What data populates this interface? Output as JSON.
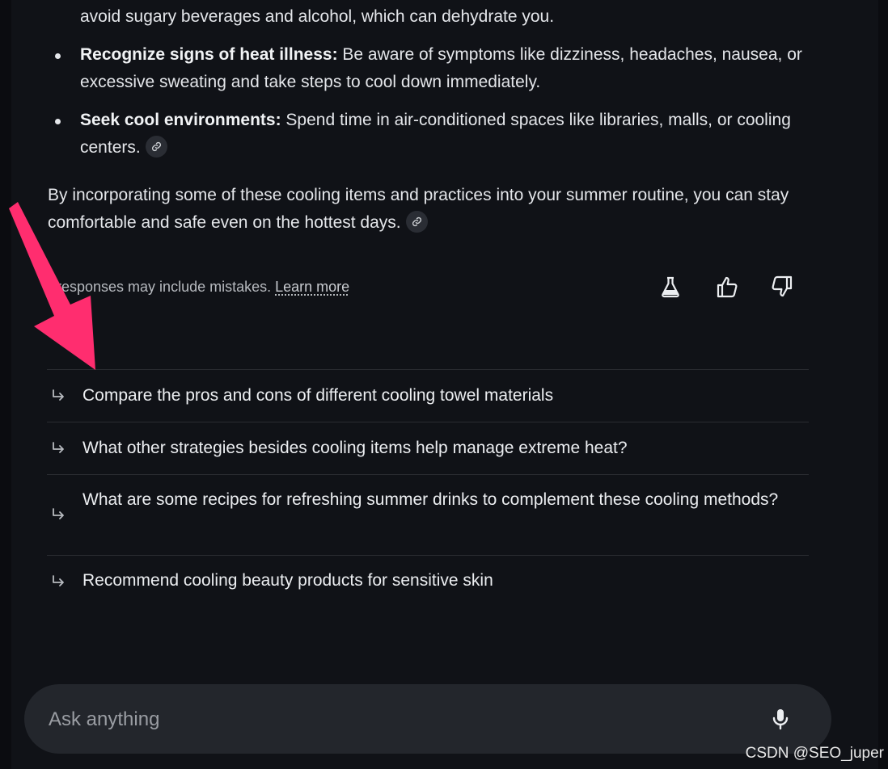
{
  "response": {
    "hydrate_continuation": "avoid sugary beverages and alcohol, which can dehydrate you.",
    "bullets": [
      {
        "bold": "Recognize signs of heat illness:",
        "text": " Be aware of symptoms like dizziness, headaches, nausea, or excessive sweating and take steps to cool down immediately."
      },
      {
        "bold": "Seek cool environments:",
        "text": " Spend time in air-conditioned spaces like libraries, malls, or cooling centers."
      }
    ],
    "closing_paragraph": "By incorporating some of these cooling items and practices into your summer routine, you can stay comfortable and safe even on the hottest days."
  },
  "disclaimer": {
    "text": "responses may include mistakes.",
    "learn_more": "Learn more"
  },
  "actions": {
    "labs_icon": "flask-icon",
    "thumbs_up_icon": "thumbs-up-icon",
    "thumbs_down_icon": "thumbs-down-icon"
  },
  "suggestions": [
    "Compare the pros and cons of different cooling towel materials",
    "What other strategies besides cooling items help manage extreme heat?",
    "What are some recipes for refreshing summer drinks to complement these cooling methods?",
    "Recommend cooling beauty products for sensitive skin"
  ],
  "ask_bar": {
    "placeholder": "Ask anything",
    "mic_icon": "microphone-icon"
  },
  "annotation": {
    "arrow_color": "#ff2d6f"
  },
  "watermark": "CSDN @SEO_juper"
}
